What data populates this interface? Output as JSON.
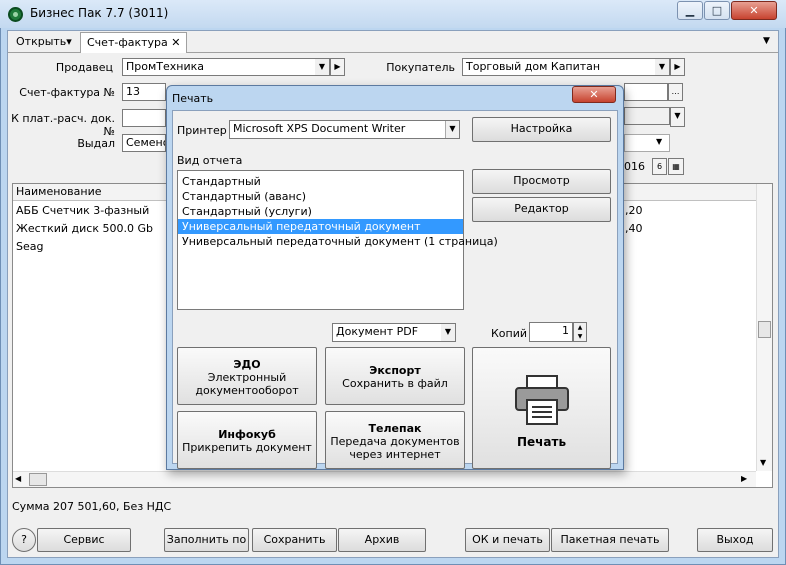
{
  "window": {
    "title": "Бизнес Пак 7.7 (3011)",
    "minimize": "▁",
    "maximize": "□",
    "close": "✕"
  },
  "tabs": [
    {
      "label": "Открыть▾"
    },
    {
      "label": "Счет-фактура ✕"
    }
  ],
  "form": {
    "seller_label": "Продавец",
    "seller_value": "ПромТехника",
    "buyer_label": "Покупатель",
    "buyer_value": "Торговый дом Капитан",
    "invoice_label": "Счет-фактура №",
    "invoice_value": "13",
    "payment_label": "К плат.-расч. док. №",
    "payment_value": "",
    "issued_label": "Выдал",
    "issued_value": "Семенов",
    "date_fragment": "016",
    "calendar_icon": "▦",
    "date_btn": "6"
  },
  "grid": {
    "header_name": "Наименование",
    "rows": [
      {
        "name": "АББ Счетчик 3-фазный",
        "right": ",20"
      },
      {
        "name": "Жесткий диск 500.0 Gb Seag",
        "right": ",40"
      }
    ]
  },
  "status": {
    "sum_text": "Сумма 207 501,60, Без НДС"
  },
  "bottom_buttons": {
    "help": "?",
    "service": "Сервис",
    "fill": "Заполнить по",
    "save": "Сохранить",
    "archive": "Архив",
    "ok_print": "ОК и печать",
    "batch_print": "Пакетная печать",
    "exit": "Выход"
  },
  "dialog": {
    "title": "Печать",
    "close": "✕",
    "printer_label": "Принтер",
    "printer_value": "Microsoft XPS Document Writer",
    "settings_button": "Настройка",
    "report_type_label": "Вид отчета",
    "report_items": [
      "Стандартный",
      "Стандартный (аванс)",
      "Стандартный (услуги)",
      "Универсальный передаточный документ",
      "Универсальный передаточный документ (1 страница)"
    ],
    "selected_index": 3,
    "preview_button": "Просмотр",
    "editor_button": "Редактор",
    "format_value": "Документ PDF",
    "copies_label": "Копий",
    "copies_value": "1",
    "edo_title": "ЭДО",
    "edo_sub1": "Электронный",
    "edo_sub2": "документооборот",
    "export_title": "Экспорт",
    "export_sub": "Сохранить в файл",
    "infocube_title": "Инфокуб",
    "infocube_sub": "Прикрепить документ",
    "telepak_title": "Телепак",
    "telepak_sub1": "Передача документов",
    "telepak_sub2": "через интернет",
    "print_button": "Печать"
  }
}
